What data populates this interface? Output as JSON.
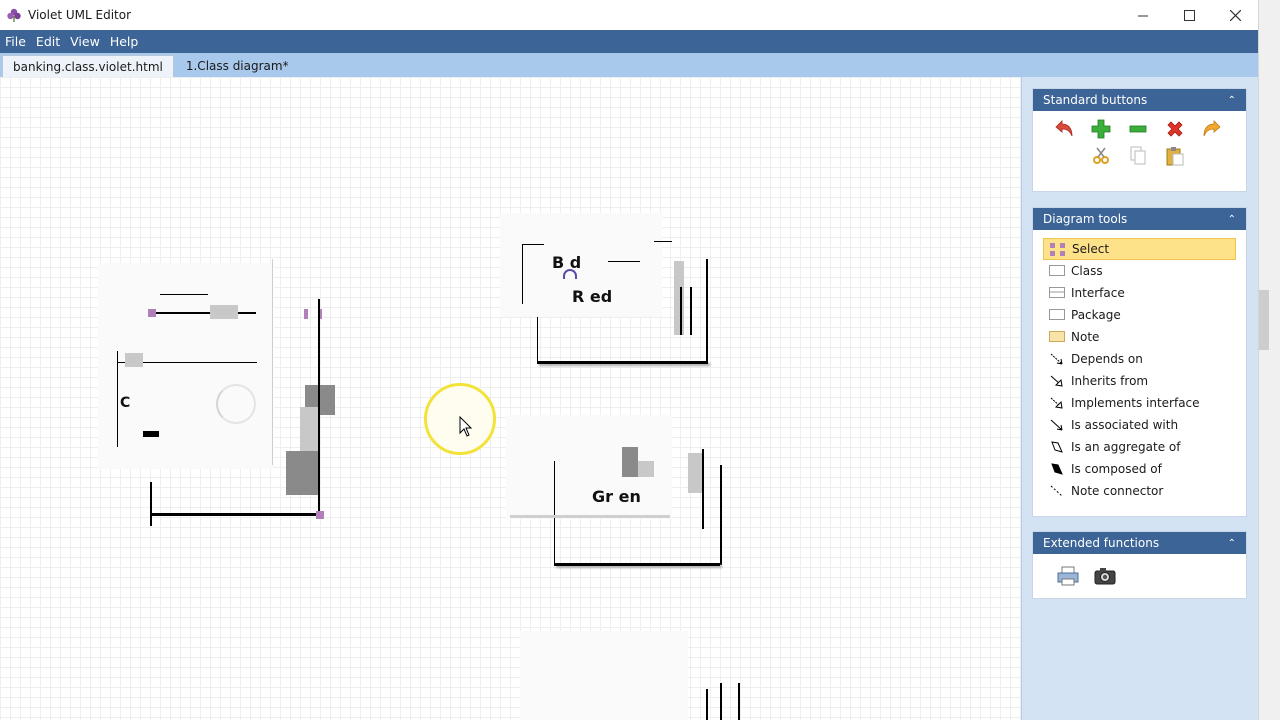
{
  "window": {
    "title": "Violet UML Editor",
    "controls": {
      "minimize": "—",
      "maximize": "☐",
      "close": "✕"
    }
  },
  "menubar": {
    "items": [
      {
        "label": "File"
      },
      {
        "label": "Edit"
      },
      {
        "label": "View"
      },
      {
        "label": "Help"
      }
    ]
  },
  "tabs": [
    {
      "label": "banking.class.violet.html",
      "active": false
    },
    {
      "label": "1.Class diagram*",
      "active": true
    }
  ],
  "canvas": {
    "fragments": [
      {
        "text": "B d"
      },
      {
        "text": "R ed"
      },
      {
        "text": "C"
      },
      {
        "text": "Gr en"
      }
    ]
  },
  "side_panel": {
    "standard_buttons": {
      "title": "Standard buttons",
      "icons": [
        "undo-icon",
        "add-icon",
        "remove-icon",
        "delete-icon",
        "redo-icon",
        "cut-icon",
        "copy-icon",
        "paste-icon"
      ]
    },
    "diagram_tools": {
      "title": "Diagram tools",
      "items": [
        {
          "label": "Select",
          "selected": true
        },
        {
          "label": "Class"
        },
        {
          "label": "Interface"
        },
        {
          "label": "Package"
        },
        {
          "label": "Note"
        },
        {
          "label": "Depends on"
        },
        {
          "label": "Inherits from"
        },
        {
          "label": "Implements interface"
        },
        {
          "label": "Is associated with"
        },
        {
          "label": "Is an aggregate of"
        },
        {
          "label": "Is composed of"
        },
        {
          "label": "Note connector"
        }
      ]
    },
    "extended_functions": {
      "title": "Extended functions",
      "icons": [
        "print-icon",
        "camera-icon"
      ]
    }
  },
  "colors": {
    "menubar": "#3c6497",
    "tabbar": "#a9c9ec",
    "panel_bg": "#d4e3f3",
    "selected_tool": "#fde28a",
    "cursor_halo": "#f2e23a"
  }
}
